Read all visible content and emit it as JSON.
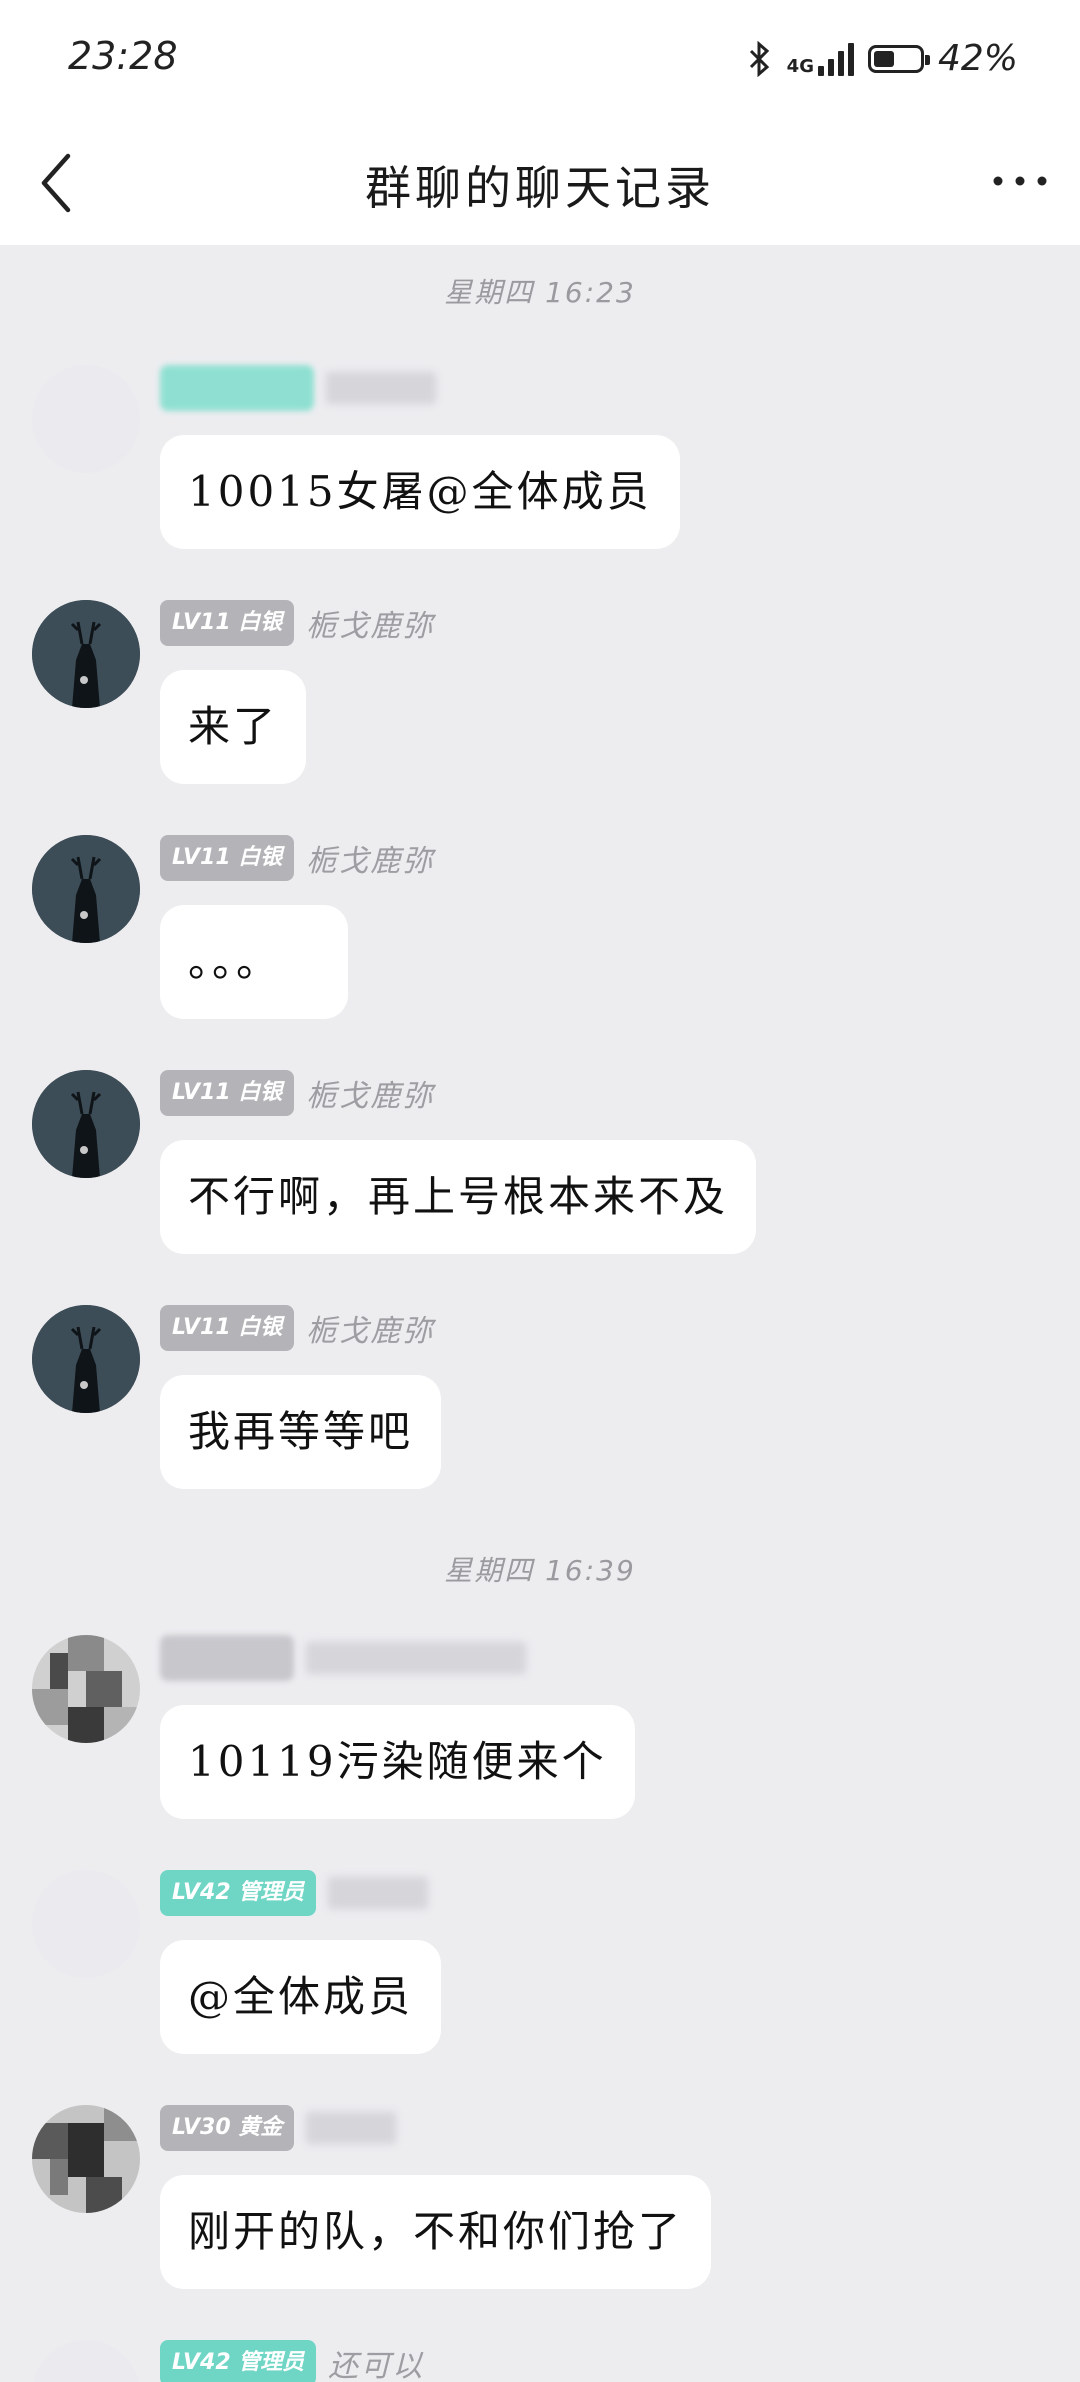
{
  "status": {
    "time": "23:28",
    "network": "4G",
    "battery": "42%"
  },
  "header": {
    "title": "群聊的聊天记录"
  },
  "timestamps": [
    "星期四 16:23",
    "星期四 16:39"
  ],
  "messages": [
    {
      "tag": "",
      "name": "",
      "text": "10015女屠@全体成员"
    },
    {
      "tag": "LV11 白银",
      "name": "栀戈鹿弥",
      "text": "来了"
    },
    {
      "tag": "LV11 白银",
      "name": "栀戈鹿弥",
      "text": "。。。"
    },
    {
      "tag": "LV11 白银",
      "name": "栀戈鹿弥",
      "text": "不行啊，再上号根本来不及"
    },
    {
      "tag": "LV11 白银",
      "name": "栀戈鹿弥",
      "text": "我再等等吧"
    },
    {
      "tag": "",
      "name": "",
      "text": "10119污染随便来个"
    },
    {
      "tag": "LV42 管理员",
      "name": "",
      "text": "@全体成员"
    },
    {
      "tag": "LV30 黄金",
      "name": "",
      "text": "刚开的队，不和你们抢了"
    },
    {
      "tag": "LV42 管理员",
      "name": "还可以",
      "text": ""
    }
  ]
}
